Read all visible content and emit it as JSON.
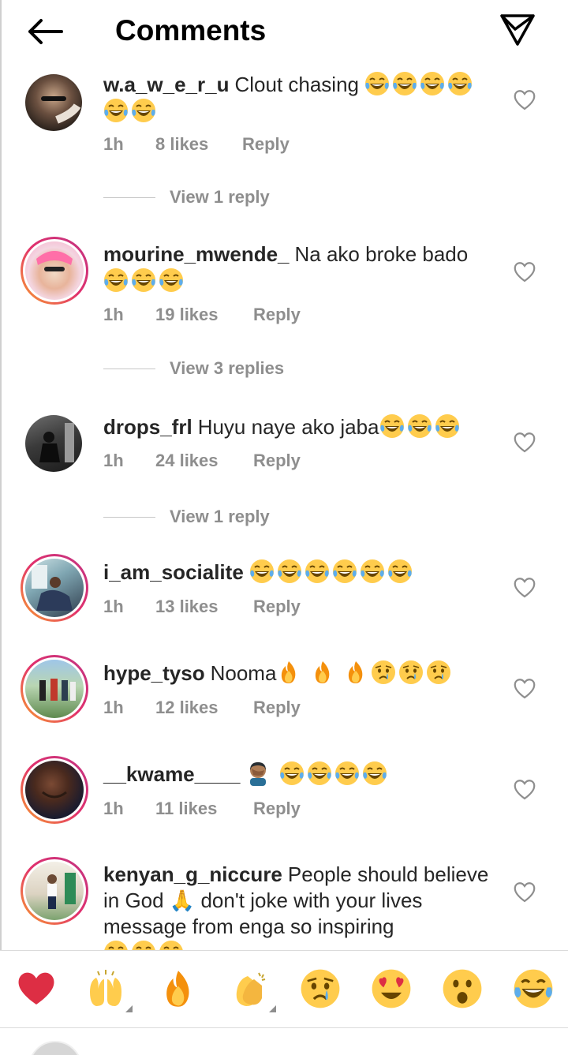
{
  "header": {
    "title": "Comments",
    "back_icon": "arrow-left-icon",
    "share_icon": "paper-plane-icon"
  },
  "comments": [
    {
      "username": "w.a_w_e_r_u",
      "text": "Clout chasing",
      "emojis": [
        "joy",
        "joy",
        "joy",
        "joy",
        "joy",
        "joy"
      ],
      "time": "1h",
      "likes": "8 likes",
      "reply": "Reply",
      "view_replies": "View 1 reply",
      "story_ring": false
    },
    {
      "username": "mourine_mwende_",
      "text": "Na ako broke bado",
      "emojis": [
        "joy",
        "joy",
        "joy"
      ],
      "time": "1h",
      "likes": "19 likes",
      "reply": "Reply",
      "view_replies": "View 3 replies",
      "story_ring": true
    },
    {
      "username": "drops_frl",
      "text": "Huyu naye ako jaba",
      "emojis": [
        "joy",
        "joy",
        "joy"
      ],
      "time": "1h",
      "likes": "24 likes",
      "reply": "Reply",
      "view_replies": "View 1 reply",
      "story_ring": false
    },
    {
      "username": "i_am_socialite",
      "text": "",
      "emojis": [
        "joy",
        "joy",
        "joy",
        "joy",
        "joy",
        "joy"
      ],
      "time": "1h",
      "likes": "13 likes",
      "reply": "Reply",
      "story_ring": true
    },
    {
      "username": "hype_tyso",
      "text": "Nooma",
      "emojis": [
        "fire",
        "fire",
        "fire",
        "cry",
        "cry",
        "cry"
      ],
      "time": "1h",
      "likes": "12 likes",
      "reply": "Reply",
      "story_ring": true
    },
    {
      "username": "__kwame____",
      "text": "",
      "emojis": [
        "facepalm",
        "joy",
        "joy",
        "joy",
        "joy"
      ],
      "time": "1h",
      "likes": "11 likes",
      "reply": "Reply",
      "story_ring": true
    },
    {
      "username": "kenyan_g_niccure",
      "text_part1": "People should believe in God",
      "text_part2": "don't joke with your lives message from enga so inspiring",
      "emojis": [
        "joy",
        "joy",
        "joy"
      ],
      "story_ring": true
    }
  ],
  "reactions": [
    "red-heart-icon",
    "raising-hands-icon",
    "fire-icon",
    "clapping-hands-icon",
    "crying-face-icon",
    "heart-eyes-icon",
    "surprised-face-icon",
    "tears-of-joy-icon"
  ],
  "colors": {
    "accent_ring_start": "#f9a02f",
    "accent_ring_end": "#c13584",
    "meta": "#8e8e8e",
    "text": "#262626"
  }
}
